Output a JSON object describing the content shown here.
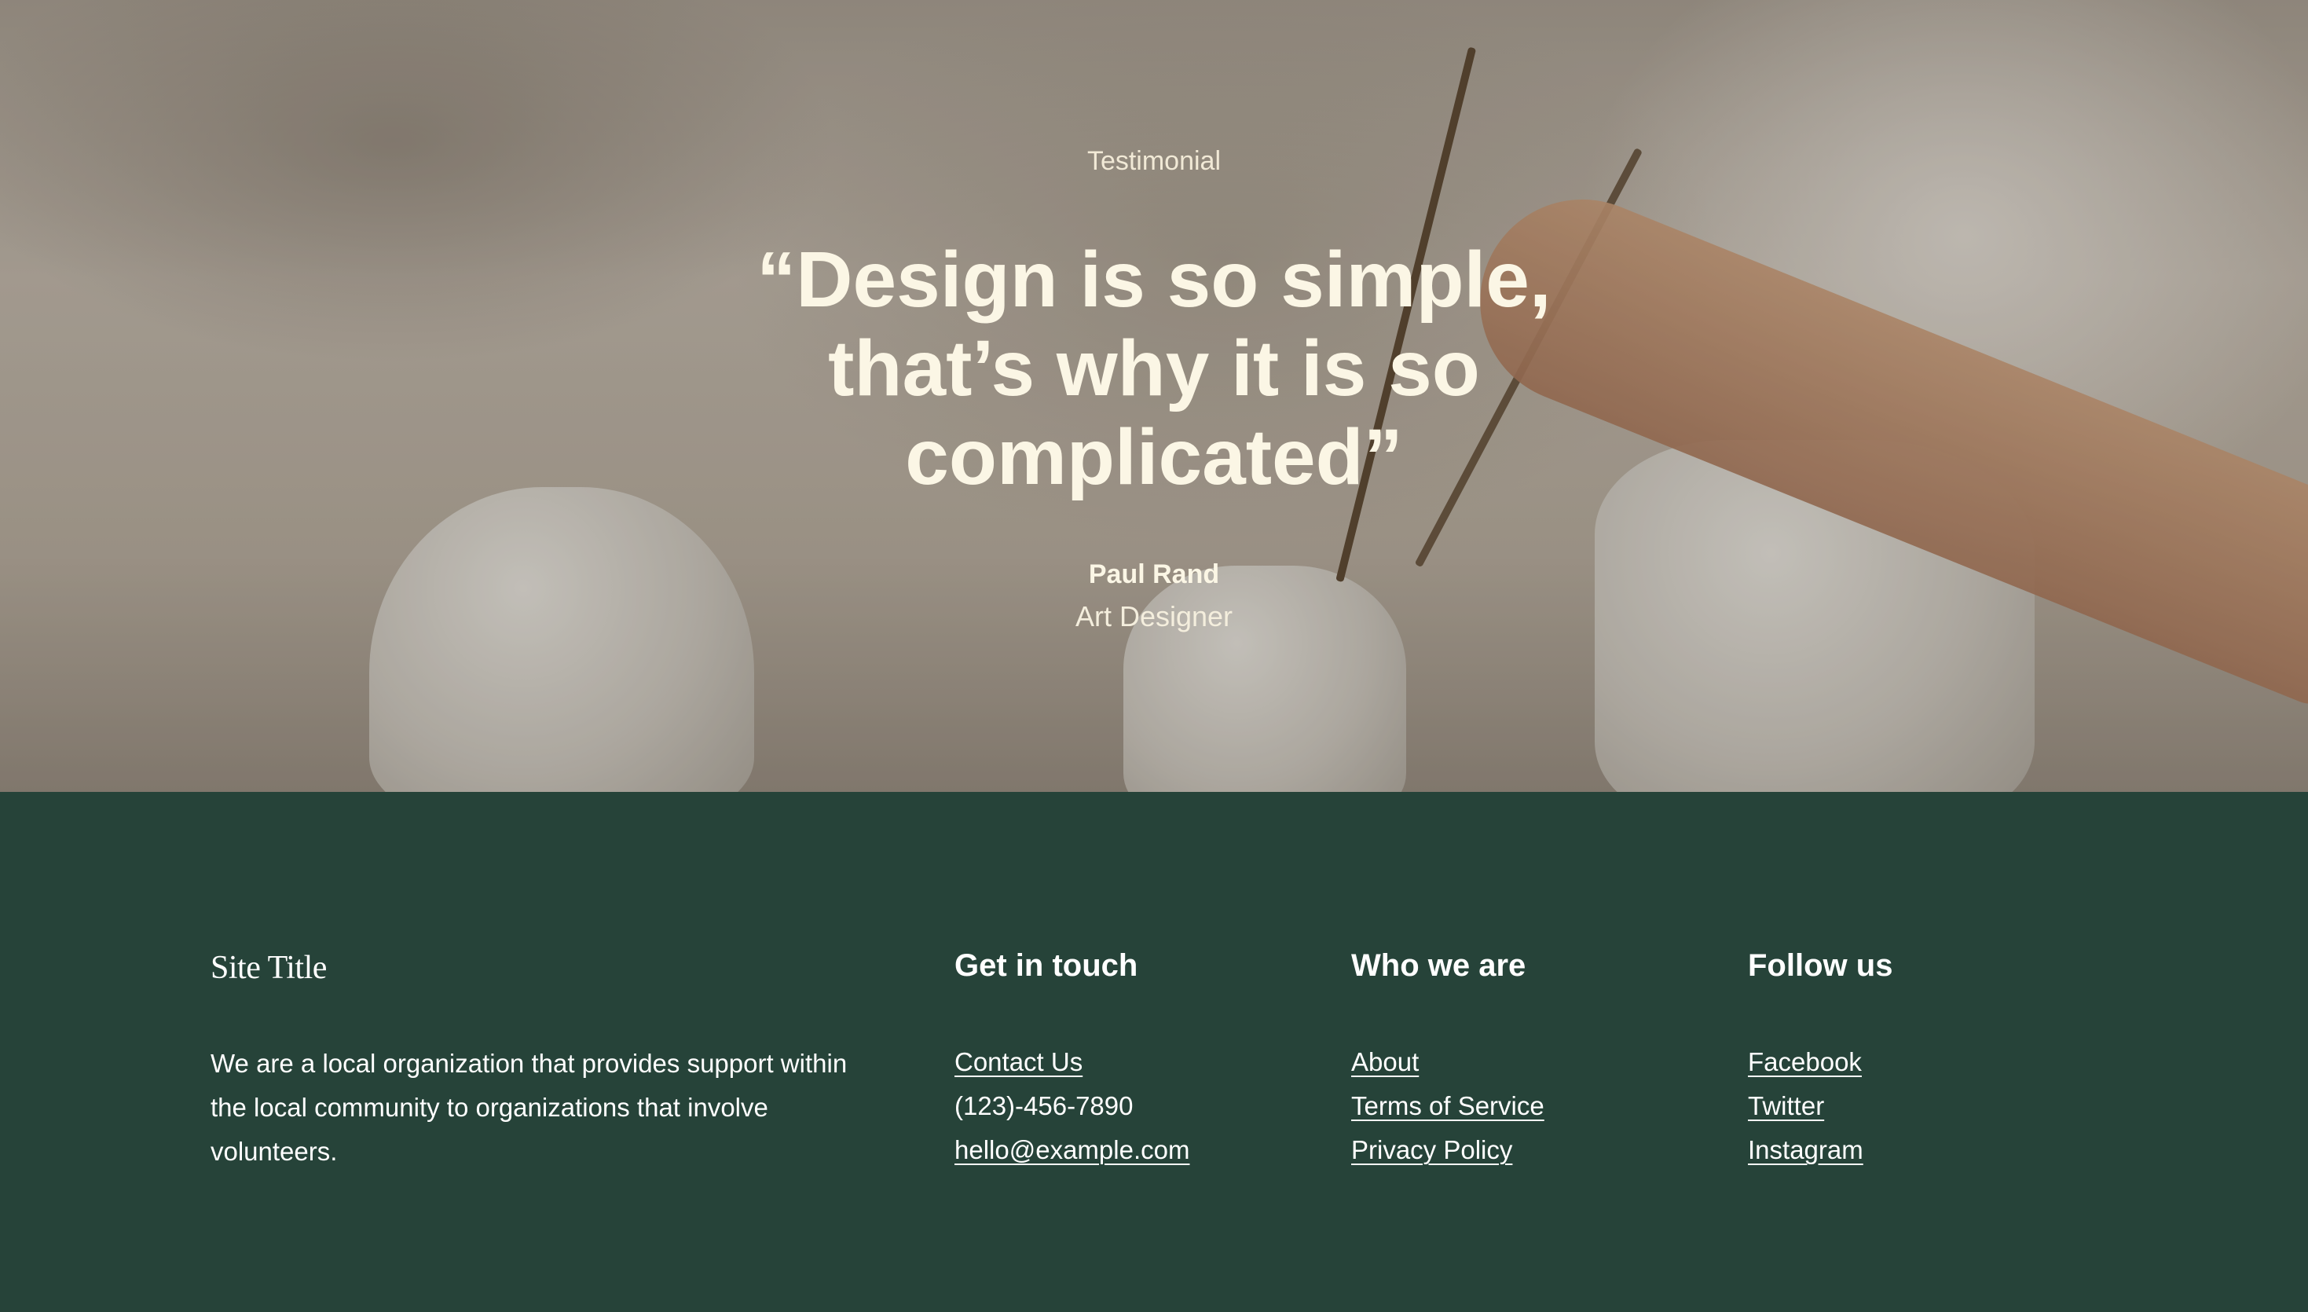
{
  "hero": {
    "eyebrow": "Testimonial",
    "quote": "“Design is so simple, that’s why it is so complicated”",
    "author_name": "Paul Rand",
    "author_role": "Art Designer"
  },
  "footer": {
    "site_title": "Site Title",
    "about": "We are a local organization that provides support within the local community to organizations that involve volunteers.",
    "columns": [
      {
        "heading": "Get in touch",
        "items": [
          "Contact Us",
          "(123)-456-7890",
          "hello@example.com"
        ]
      },
      {
        "heading": "Who we are",
        "items": [
          "About",
          "Terms of Service",
          "Privacy Policy"
        ]
      },
      {
        "heading": "Follow us",
        "items": [
          "Facebook",
          "Twitter",
          "Instagram"
        ]
      }
    ]
  },
  "colors": {
    "footer_bg": "#264339",
    "hero_text": "#fbf6e5"
  }
}
